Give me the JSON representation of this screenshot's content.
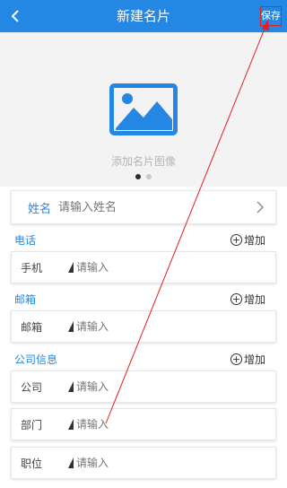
{
  "header": {
    "title": "新建名片",
    "save_label": "保存"
  },
  "image_area": {
    "label": "添加名片图像",
    "dots": 2,
    "active_dot": 0
  },
  "name_field": {
    "label": "姓名",
    "placeholder": "请输入姓名"
  },
  "sections": {
    "phone": {
      "title": "电话",
      "add_label": "增加",
      "field_label": "手机",
      "placeholder": "请输入"
    },
    "email": {
      "title": "邮箱",
      "add_label": "增加",
      "field_label": "邮箱",
      "placeholder": "请输入"
    },
    "company": {
      "title": "公司信息",
      "add_label": "增加",
      "fields": [
        {
          "label": "公司",
          "placeholder": "请输入"
        },
        {
          "label": "部门",
          "placeholder": "请输入"
        },
        {
          "label": "职位",
          "placeholder": "请输入"
        }
      ]
    }
  },
  "colors": {
    "accent": "#2387e3",
    "annotation": "#e02020"
  }
}
